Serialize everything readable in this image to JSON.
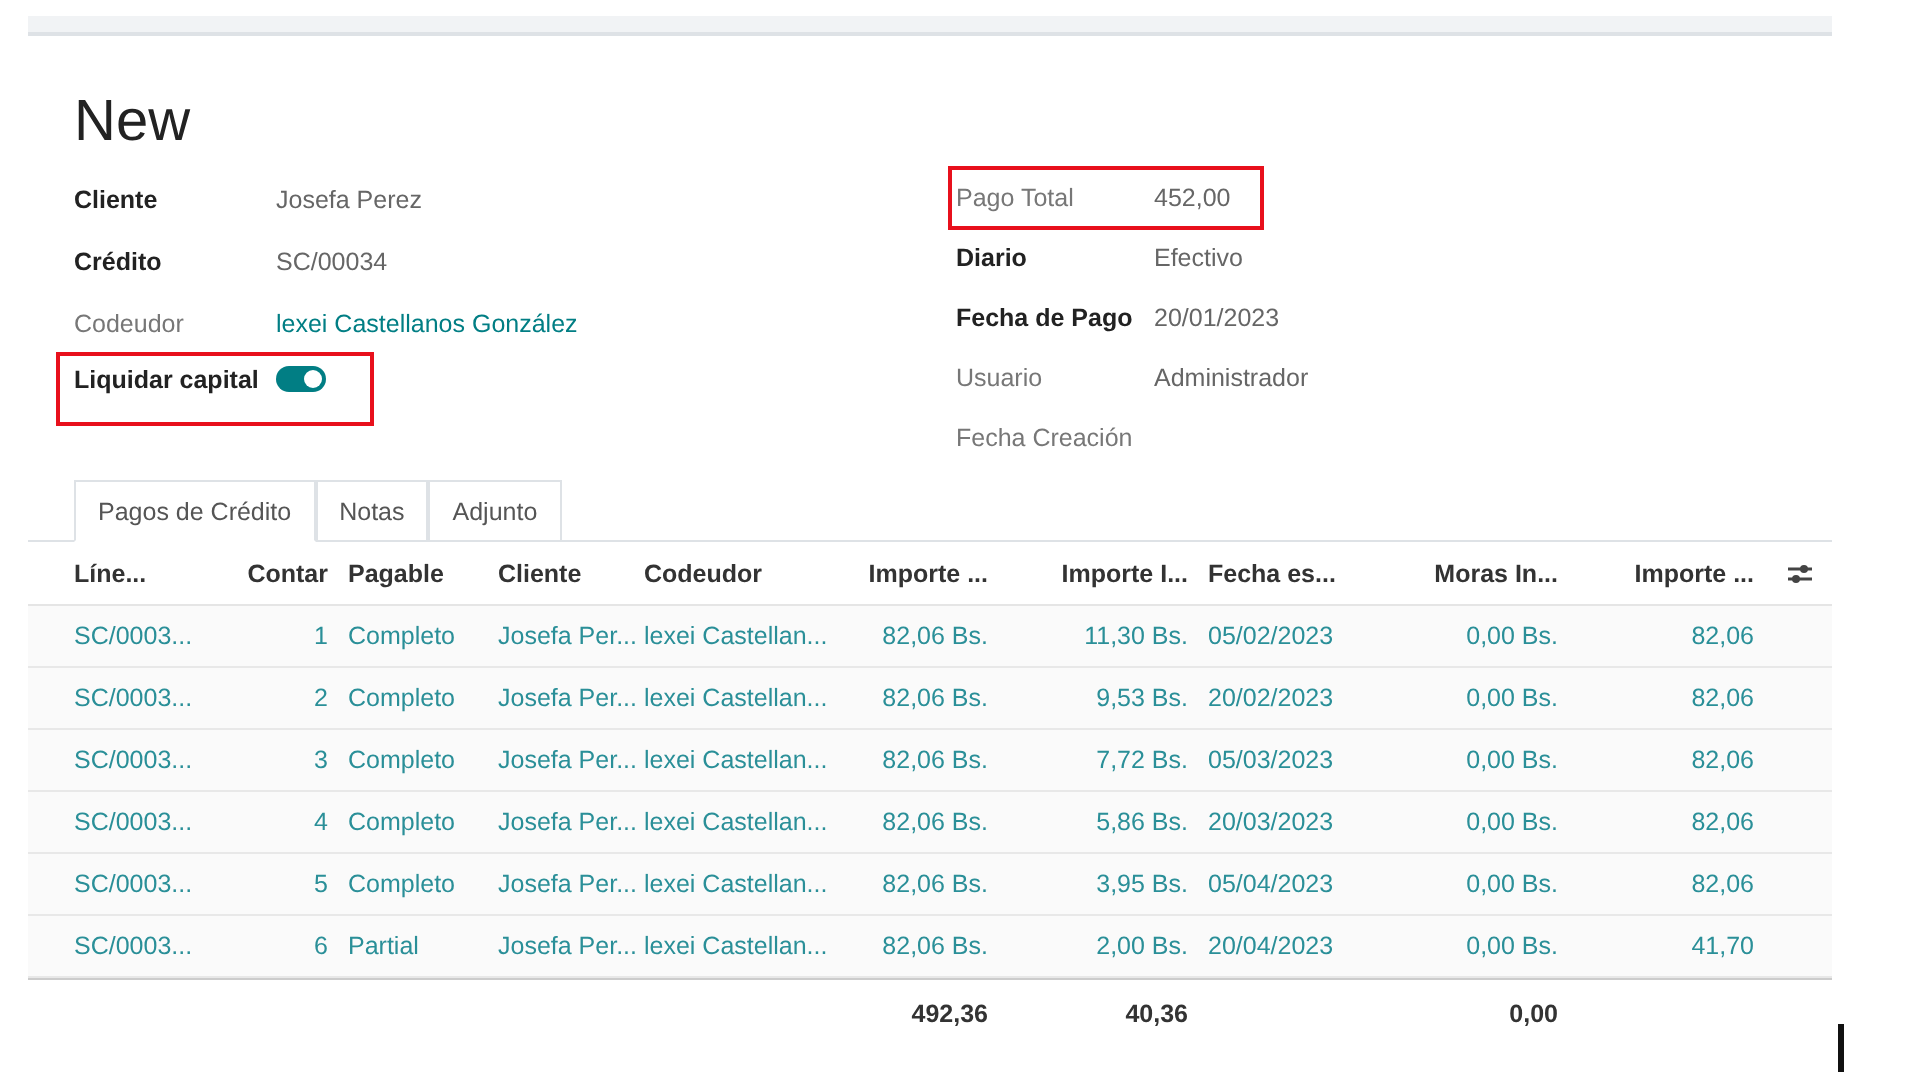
{
  "title": "New",
  "left_fields": [
    {
      "label": "Cliente",
      "required": true,
      "kind": "text",
      "value": "Josefa Perez",
      "highlighted": false
    },
    {
      "label": "Crédito",
      "required": true,
      "kind": "text",
      "value": "SC/00034",
      "highlighted": false
    },
    {
      "label": "Codeudor",
      "required": false,
      "kind": "link",
      "value": "lexei Castellanos González",
      "highlighted": false
    },
    {
      "label": "Liquidar capital",
      "required": true,
      "kind": "toggle",
      "on": true,
      "highlighted": true
    }
  ],
  "right_fields": [
    {
      "label": "Pago Total",
      "required": false,
      "kind": "text",
      "value": "452,00",
      "highlighted": true
    },
    {
      "label": "Diario",
      "required": true,
      "kind": "text",
      "value": "Efectivo",
      "highlighted": false
    },
    {
      "label": "Fecha de Pago",
      "required": true,
      "kind": "text",
      "value": "20/01/2023",
      "highlighted": false
    },
    {
      "label": "Usuario",
      "required": false,
      "kind": "text",
      "value": "Administrador",
      "highlighted": false
    },
    {
      "label": "Fecha Creación",
      "required": false,
      "kind": "text",
      "highlighted": false
    }
  ],
  "tabs": [
    {
      "label": "Pagos de Crédito",
      "selected": true
    },
    {
      "label": "Notas",
      "selected": false
    },
    {
      "label": "Adjunto",
      "selected": false
    }
  ],
  "table": {
    "columns": [
      {
        "label": "Líne...",
        "kind": "text"
      },
      {
        "label": "Contar",
        "kind": "number"
      },
      {
        "label": "Pagable",
        "kind": "text"
      },
      {
        "label": "Cliente",
        "kind": "text"
      },
      {
        "label": "Codeudor",
        "kind": "text"
      },
      {
        "label": "Importe ...",
        "kind": "number",
        "total": "492,36"
      },
      {
        "label": "Importe I...",
        "kind": "number",
        "total": "40,36"
      },
      {
        "label": "Fecha es...",
        "kind": "text"
      },
      {
        "label": "Moras In...",
        "kind": "number",
        "total": "0,00"
      },
      {
        "label": "Importe ...",
        "kind": "number"
      }
    ],
    "rows": [
      [
        "SC/0003...",
        "1",
        "Completo",
        "Josefa Per...",
        "lexei Castellan...",
        "82,06 Bs.",
        "11,30 Bs.",
        "05/02/2023",
        "0,00 Bs.",
        "82,06"
      ],
      [
        "SC/0003...",
        "2",
        "Completo",
        "Josefa Per...",
        "lexei Castellan...",
        "82,06 Bs.",
        "9,53 Bs.",
        "20/02/2023",
        "0,00 Bs.",
        "82,06"
      ],
      [
        "SC/0003...",
        "3",
        "Completo",
        "Josefa Per...",
        "lexei Castellan...",
        "82,06 Bs.",
        "7,72 Bs.",
        "05/03/2023",
        "0,00 Bs.",
        "82,06"
      ],
      [
        "SC/0003...",
        "4",
        "Completo",
        "Josefa Per...",
        "lexei Castellan...",
        "82,06 Bs.",
        "5,86 Bs.",
        "20/03/2023",
        "0,00 Bs.",
        "82,06"
      ],
      [
        "SC/0003...",
        "5",
        "Completo",
        "Josefa Per...",
        "lexei Castellan...",
        "82,06 Bs.",
        "3,95 Bs.",
        "05/04/2023",
        "0,00 Bs.",
        "82,06"
      ],
      [
        "SC/0003...",
        "6",
        "Partial",
        "Josefa Per...",
        "lexei Castellan...",
        "82,06 Bs.",
        "2,00 Bs.",
        "20/04/2023",
        "0,00 Bs.",
        "41,70"
      ]
    ]
  }
}
